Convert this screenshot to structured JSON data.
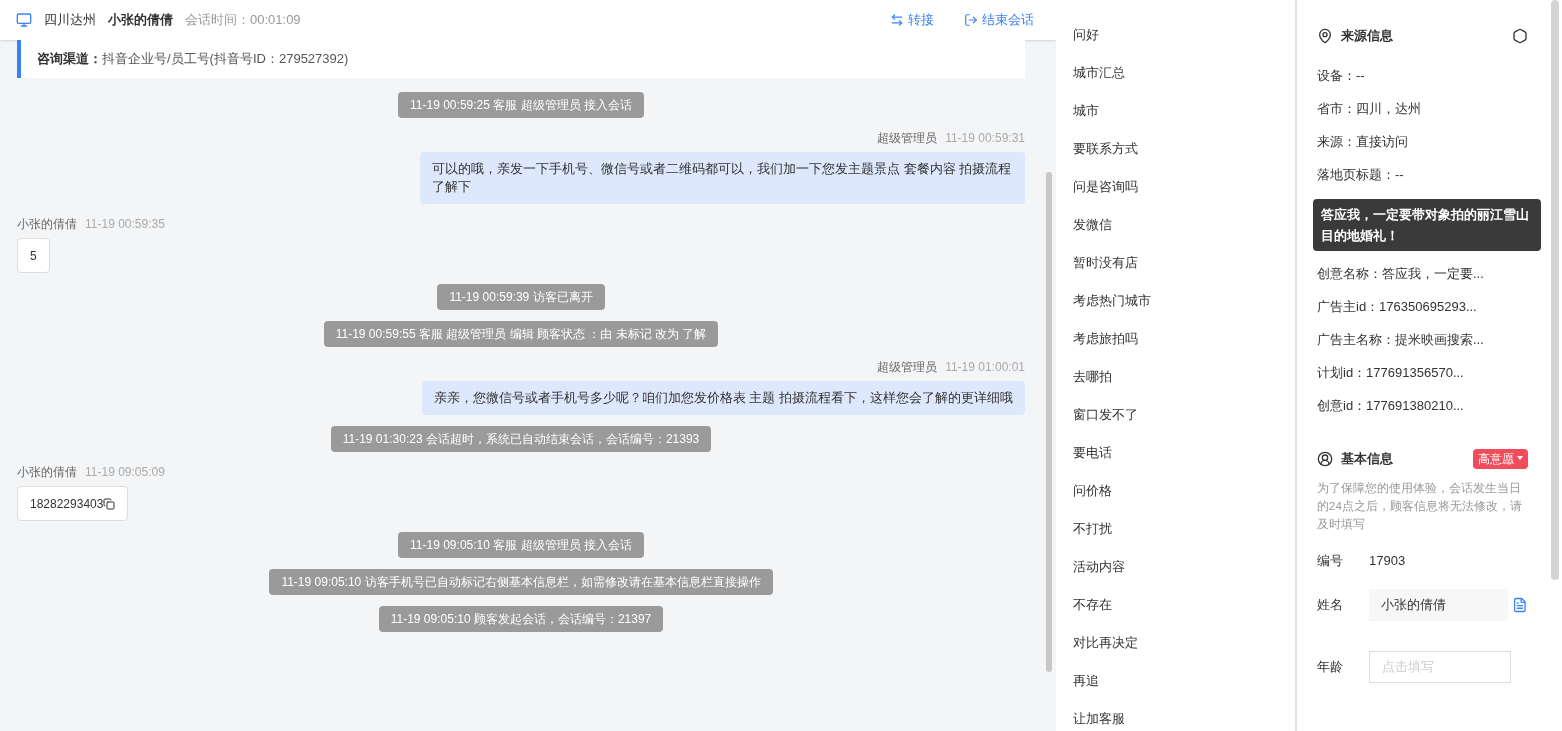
{
  "header": {
    "location": "四川达州",
    "customer": "小张的倩倩",
    "duration": "会话时间：00:01:09",
    "actions": [
      {
        "kind": "transfer",
        "label": "转接"
      },
      {
        "kind": "end",
        "label": "结束会话"
      }
    ]
  },
  "channel": {
    "label": "咨询渠道：",
    "value": "抖音企业号/员工号(抖音号ID：279527392)"
  },
  "messages": [
    {
      "kind": "system",
      "text": "11-19 00:59:25 客服 超级管理员 接入会话"
    },
    {
      "kind": "agent",
      "sender": "超级管理员",
      "time": "11-19 00:59:31",
      "text": "可以的哦，亲发一下手机号、微信号或者二维码都可以，我们加一下您发主题景点 套餐内容 拍摄流程了解下"
    },
    {
      "kind": "visitor",
      "sender": "小张的倩倩",
      "time": "11-19 00:59:35",
      "text": "5",
      "copyable": false
    },
    {
      "kind": "system",
      "text": "11-19 00:59:39 访客已离开"
    },
    {
      "kind": "system",
      "text": "11-19 00:59:55 客服 超级管理员 编辑 顾客状态 ：由 未标记 改为 了解"
    },
    {
      "kind": "agent",
      "sender": "超级管理员",
      "time": "11-19 01:00:01",
      "text": "亲亲，您微信号或者手机号多少呢？咱们加您发价格表 主题 拍摄流程看下，这样您会了解的更详细哦"
    },
    {
      "kind": "system",
      "text": "11-19 01:30:23 会话超时，系统已自动结束会话，会话编号：21393"
    },
    {
      "kind": "visitor",
      "sender": "小张的倩倩",
      "time": "11-19 09:05:09",
      "text": "18282293403",
      "copyable": true
    },
    {
      "kind": "system",
      "text": "11-19 09:05:10 客服 超级管理员 接入会话"
    },
    {
      "kind": "system",
      "text": "11-19 09:05:10 访客手机号已自动标记右侧基本信息栏，如需修改请在基本信息栏直接操作"
    },
    {
      "kind": "system",
      "text": "11-19 09:05:10 顾客发起会话，会话编号：21397"
    }
  ],
  "quick_replies": [
    "问好",
    "城市汇总",
    "城市",
    "要联系方式",
    "问是咨询吗",
    "发微信",
    "暂时没有店",
    "考虑热门城市",
    "考虑旅拍吗",
    "去哪拍",
    "窗口发不了",
    "要电话",
    "问价格",
    "不打扰",
    "活动内容",
    "不存在",
    "对比再决定",
    "再追",
    "让加客服"
  ],
  "source_info": {
    "title": "来源信息",
    "rows": [
      "设备：--",
      "省市：四川，达州",
      "来源：直接访问",
      "落地页标题：--"
    ],
    "rows_below": [
      "创意名称：答应我，一定要...",
      "广告主id：176350695293...",
      "广告主名称：提米映画搜索...",
      "计划id：177691356570...",
      "创意id：177691380210..."
    ],
    "tooltip": "答应我，一定要带对象拍的丽江雪山目的地婚礼！"
  },
  "basic_info": {
    "title": "基本信息",
    "intent": "高意愿",
    "note": "为了保障您的使用体验，会话发生当日的24点之后，顾客信息将无法修改，请及时填写",
    "fields": [
      {
        "kind": "text",
        "label": "编号",
        "value": "17903"
      },
      {
        "kind": "filled",
        "label": "姓名",
        "value": "小张的倩倩"
      },
      {
        "kind": "input",
        "label": "年龄",
        "placeholder": "点击填写"
      }
    ]
  }
}
